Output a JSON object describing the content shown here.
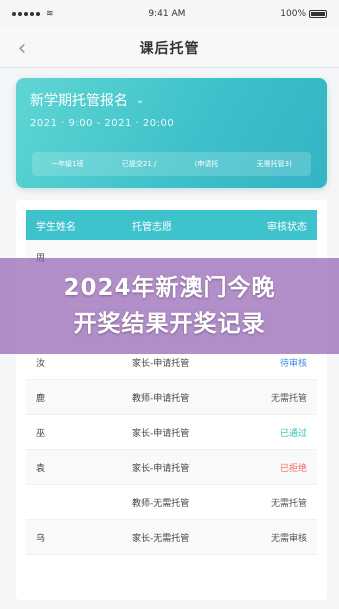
{
  "status_bar": {
    "time": "9:41 AM",
    "battery": "100%"
  },
  "nav": {
    "title": "课后托管"
  },
  "banner": {
    "title": "新学期托管报名",
    "time": "2021  ·  9:00 - 2021  ·  20:00",
    "stats": [
      "一年级1班",
      "已提交21 /",
      "(申请托",
      "无需托管3)"
    ]
  },
  "table": {
    "headers": [
      "学生姓名",
      "托管志愿",
      "审核状态"
    ],
    "rows": [
      {
        "name": "周",
        "type": "",
        "status": "",
        "status_class": "status-pending"
      },
      {
        "name": "",
        "type": "",
        "status": "",
        "status_class": "status-none"
      },
      {
        "name": "",
        "type": "",
        "status": "",
        "status_class": "status-none"
      },
      {
        "name": "汝",
        "type": "家长-申请托管",
        "status": "待审核",
        "status_class": "status-pending"
      },
      {
        "name": "鹿",
        "type": "教师-申请托管",
        "status": "无需托管",
        "status_class": "status-none"
      },
      {
        "name": "巫",
        "type": "家长-申请托管",
        "status": "已通过",
        "status_class": "status-passed"
      },
      {
        "name": "袁",
        "type": "家长-申请托管",
        "status": "已拒绝",
        "status_class": "status-rejected"
      },
      {
        "name": "",
        "type": "教师-无需托管",
        "status": "无需托管",
        "status_class": "status-none"
      },
      {
        "name": "乌",
        "type": "家长-无需托管",
        "status": "无需审核",
        "status_class": "status-none"
      }
    ]
  },
  "overlay": {
    "line1": "2024年新澳门今晚",
    "line2": "开奖结果开奖记录"
  },
  "icons": {
    "back": "back-chevron-icon",
    "dropdown": "chevron-down-icon",
    "signal": "signal-icon",
    "wifi": "wifi-icon",
    "battery": "battery-icon"
  },
  "colors": {
    "accent": "#3ec3cc",
    "overlay": "#9664b4",
    "pending": "#3d8fe0",
    "passed": "#2fbfb0",
    "rejected": "#f06a5a"
  }
}
